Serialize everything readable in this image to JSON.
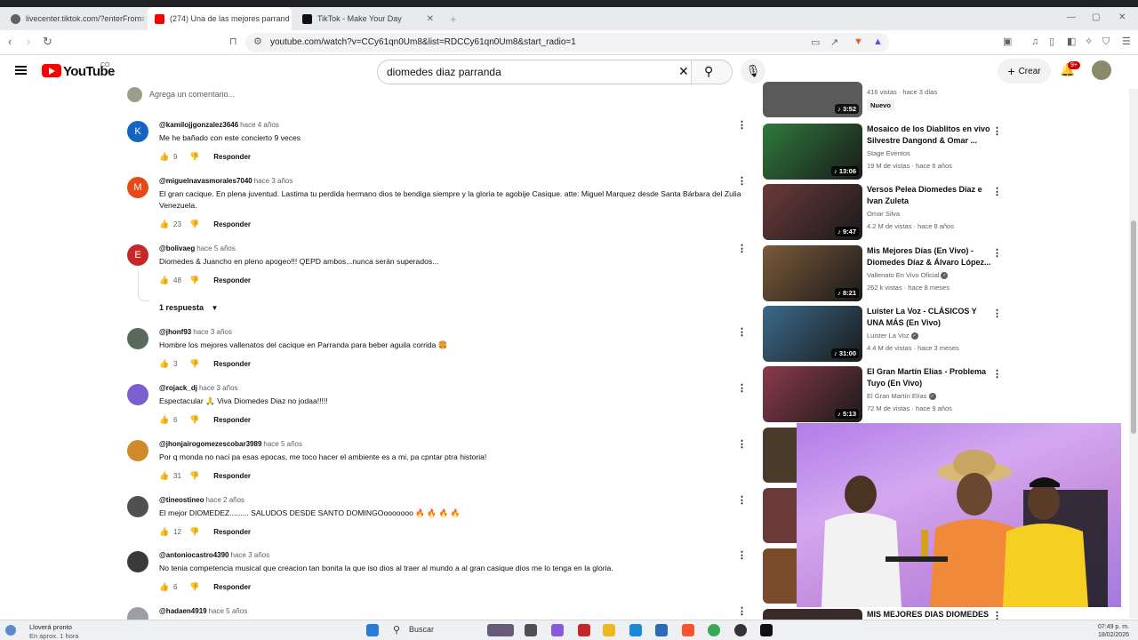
{
  "browser": {
    "tabs": [
      {
        "label": "livecenter.tiktok.com/?enterFrom=pi",
        "close": ""
      },
      {
        "label": "(274) Una de las mejores parrand",
        "close": "✕"
      },
      {
        "label": "TikTok - Make Your Day",
        "close": "✕"
      }
    ],
    "new_tab": "+",
    "url": "youtube.com/watch?v=CCy61qn0Um8&list=RDCCy61qn0Um8&start_radio=1",
    "extension_badge": "1"
  },
  "youtube": {
    "logo_text": "YouTube",
    "country": "CO",
    "search_value": "diomedes diaz parranda",
    "create_label": "Crear",
    "notif_badge": "9+"
  },
  "comments": {
    "add_placeholder": "Agrega un comentario...",
    "reply_label": "Responder",
    "replies_toggle": "1 respuesta",
    "items": [
      {
        "initial": "K",
        "color": "#1565c0",
        "user": "@kamilojjgonzalez3646",
        "time": "hace 4 años",
        "text": "Me he bañado con este concierto 9 veces",
        "likes": "9"
      },
      {
        "initial": "M",
        "color": "#e64a19",
        "user": "@miguelnavasmorales7040",
        "time": "hace 3 años",
        "text": "El gran cacique. En plena juventud. Lastima tu perdida hermano dios te bendiga siempre y la gloria te agobije Casique.  atte: Miguel Marquez desde Santa Bárbara del Zulia Venezuela.",
        "likes": "23"
      },
      {
        "initial": "E",
        "color": "#c62828",
        "user": "@bolivaeg",
        "time": "hace 5 años",
        "text": "Diomedes & Juancho en pleno apogeo!!! QEPD ambos...nunca serán superados...",
        "likes": "48"
      },
      {
        "initial": "",
        "color": "#5a6a5a",
        "user": "@jhonf93",
        "time": "hace 3 años",
        "text": "Hombre los mejores vallenatos del cacique en Parranda para beber aguila corrida 🍔",
        "likes": "3"
      },
      {
        "initial": "",
        "color": "#7b5fd0",
        "user": "@rojack_dj",
        "time": "hace 3 años",
        "text": "Espectacular 🙏 Viva Diomedes Diaz no jodaa!!!!!",
        "likes": "6"
      },
      {
        "initial": "",
        "color": "#d08a2a",
        "user": "@jhonjairogomezescobar3989",
        "time": "hace 5 años",
        "text": "Por q monda no naci pa esas epocas, me toco hacer el ambiente es a mi, pa cpntar ptra historia!",
        "likes": "31"
      },
      {
        "initial": "",
        "color": "#505050",
        "user": "@tineostineo",
        "time": "hace 2 años",
        "text": "El mejor DIOMEDEZ......... SALUDOS DESDE SANTO DOMINGOooooooo 🔥 🔥 🔥 🔥",
        "likes": "12"
      },
      {
        "initial": "",
        "color": "#3a3a3a",
        "user": "@antoniocastro4390",
        "time": "hace 3 años",
        "text": "No tenia competencia musical que creacion tan bonita la que iso dios al traer al mundo a al gran casique dios me lo tenga en la gloria.",
        "likes": "6"
      },
      {
        "initial": "",
        "color": "#9aa0a6",
        "user": "@hadaen4919",
        "time": "hace 5 años",
        "text": "",
        "likes": ""
      }
    ]
  },
  "sidebar": {
    "top_partial": {
      "meta": "416 vistas · hace 3 días",
      "duration": "3:52",
      "badge": "Nuevo"
    },
    "videos": [
      {
        "title": "Mosaico de los Diablitos en vivo Silvestre Dangond & Omar ...",
        "channel": "Stage Eventos",
        "verified": false,
        "meta": "19 M de vistas · hace 6 años",
        "duration": "13:06",
        "thumb": "#2f7a3a"
      },
      {
        "title": "Versos Pelea Diomedes Díaz e Ivan Zuleta",
        "channel": "Omar Silva",
        "verified": false,
        "meta": "4.2 M de vistas · hace 8 años",
        "duration": "9:47",
        "thumb": "#6b3a3a"
      },
      {
        "title": "Mis Mejores Días (En Vivo) - Diomedes Díaz & Álvaro López...",
        "channel": "Vallenato En Vivo Oficial",
        "verified": true,
        "meta": "262 k vistas · hace 8 meses",
        "duration": "8:21",
        "thumb": "#7a5a3a"
      },
      {
        "title": "Luister La Voz - CLÁSICOS Y UNA MÁS (En Vivo)",
        "channel": "Luister La Voz",
        "verified": true,
        "meta": "4.4 M de vistas · hace 3 meses",
        "duration": "31:00",
        "thumb": "#3a6a8a"
      },
      {
        "title": "El Gran Martín Elías - Problema Tuyo (En Vivo)",
        "channel": "El Gran Martín Elías",
        "verified": true,
        "meta": "72 M de vistas · hace 9 años",
        "duration": "5:13",
        "thumb": "#8a3a4a"
      }
    ],
    "bottom_partial_title": "MIS MEJORES DIAS DIOMEDES"
  },
  "taskbar": {
    "weather_line1": "Lloverá pronto",
    "weather_line2": "En aprox. 1 hora",
    "search_label": "Buscar",
    "time": "07:49 p. m.",
    "date": "18/02/2026"
  },
  "colors": {
    "yt_red": "#ff0000",
    "accent_bell": "#cc0000"
  }
}
